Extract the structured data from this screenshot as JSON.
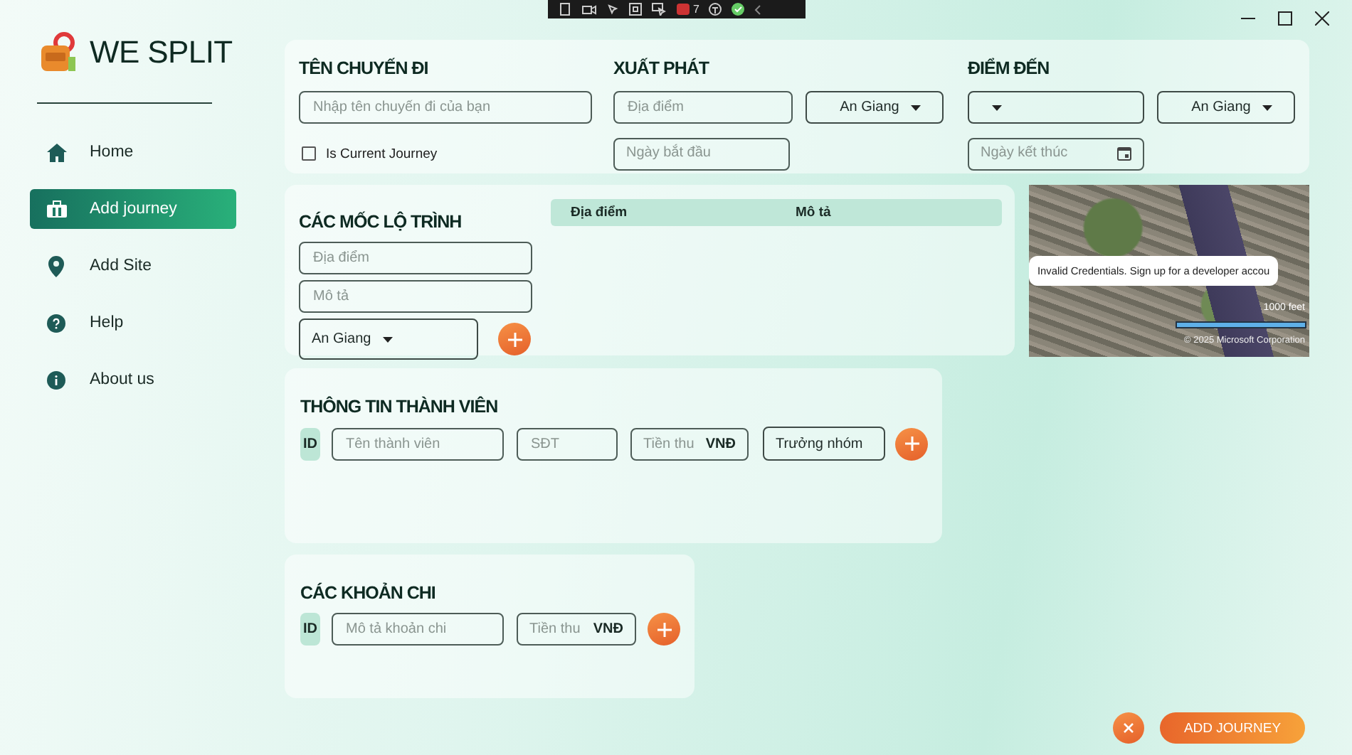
{
  "debug_toolbar": {
    "counter": "7"
  },
  "sidebar": {
    "title": "WE SPLIT",
    "items": [
      {
        "label": "Home",
        "selected": false
      },
      {
        "label": "Add journey",
        "selected": true
      },
      {
        "label": "Add Site",
        "selected": false
      },
      {
        "label": "Help",
        "selected": false
      },
      {
        "label": "About us",
        "selected": false
      }
    ]
  },
  "journey": {
    "name_heading": "TÊN CHUYẾN ĐI",
    "name_placeholder": "Nhập tên chuyến đi của bạn",
    "current_journey": {
      "label": "Is Current Journey",
      "checked": false
    },
    "departure_heading": "XUẤT PHÁT",
    "departure_place_placeholder": "Địa điểm",
    "departure_province": "An Giang",
    "start_date_placeholder": "Ngày bắt đầu",
    "destination_heading": "ĐIỂM ĐẾN",
    "destination_province": "An Giang",
    "end_date_placeholder": "Ngày kết thúc"
  },
  "milestones": {
    "heading": "CÁC MỐC LỘ TRÌNH",
    "place_placeholder": "Địa điểm",
    "description_placeholder": "Mô tả",
    "province": "An Giang",
    "table": {
      "columns": [
        "Địa điểm",
        "Mô tả"
      ]
    }
  },
  "map": {
    "message": "Invalid Credentials. Sign up for a developer accou",
    "scale_label": "1000 feet",
    "copyright": "© 2025 Microsoft Corporation"
  },
  "members": {
    "heading": "THÔNG TIN THÀNH VIÊN",
    "id_label": "ID",
    "name_placeholder": "Tên thành viên",
    "phone_placeholder": "SĐT",
    "amount_placeholder": "Tiền thu",
    "currency": "VNĐ",
    "role": "Trưởng nhóm"
  },
  "expenses": {
    "heading": "CÁC KHOẢN CHI",
    "id_label": "ID",
    "description_placeholder": "Mô tả khoản chi",
    "amount_placeholder": "Tiền thu",
    "currency": "VNĐ"
  },
  "actions": {
    "submit_label": "ADD JOURNEY"
  }
}
